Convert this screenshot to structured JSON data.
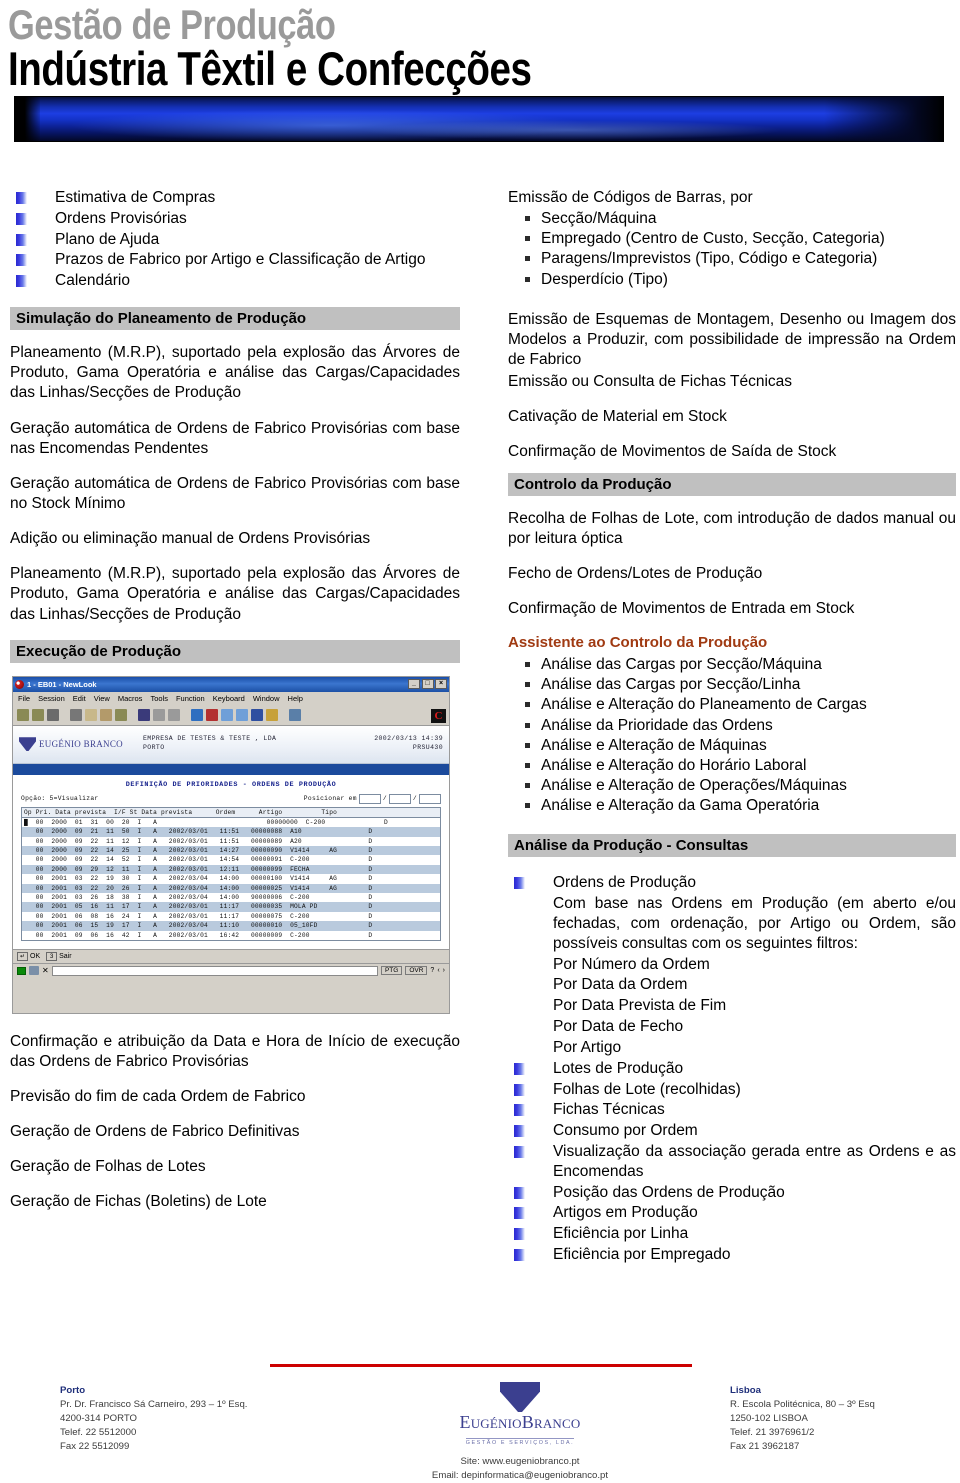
{
  "header": {
    "line1": "Gestão de Produção",
    "line2": "Indústria Têxtil e Confecções"
  },
  "left": {
    "top_bullets": [
      "Estimativa de Compras",
      "Ordens Provisórias",
      "Plano de Ajuda",
      "Prazos de Fabrico por Artigo e Classificação de Artigo",
      "Calendário"
    ],
    "section1_title": "Simulação do Planeamento de Produção",
    "section1_paras": [
      "Planeamento (M.R.P), suportado pela explosão das Árvores de Produto, Gama Operatória e análise das Cargas/Capacidades das Linhas/Secções de Produção",
      "Geração automática de Ordens de Fabrico Provisórias com base nas Encomendas Pendentes",
      "Geração automática de Ordens de Fabrico Provisórias com base no Stock Mínimo",
      "Adição ou eliminação manual de Ordens Provisórias",
      "Planeamento (M.R.P), suportado pela explosão das Árvores de Produto, Gama Operatória e análise das Cargas/Capacidades das Linhas/Secções de Produção"
    ],
    "section2_title": "Execução de Produção",
    "section2_paras": [
      "Confirmação e atribuição da Data e Hora de Início de execução das Ordens de Fabrico Provisórias",
      "Previsão do fim de cada Ordem de Fabrico",
      "Geração de Ordens de Fabrico Definitivas",
      "Geração de Folhas de Lotes",
      "Geração de Fichas (Boletins) de Lote"
    ]
  },
  "screenshot": {
    "window_title": "1 - EB01 - NewLook",
    "min_label": "_",
    "max_label": "□",
    "close_label": "×",
    "menus": [
      "File",
      "Session",
      "Edit",
      "View",
      "Macros",
      "Tools",
      "Function",
      "Keyboard",
      "Window",
      "Help"
    ],
    "company": "EMPRESA DE TESTES  & TESTE , LDA",
    "city": "PORTO",
    "datetime": "2002/03/13 14:39",
    "program_id": "PRSU430",
    "logo_text": "EUGÉNIO BRANCO",
    "form_title": "DEFINIÇÃO DE PRIORIDADES - ORDENS DE PRODUÇÃO",
    "option_label": "Opção: 5=Visualizar",
    "position_label": "Posicionar em",
    "grid_header": "Op Pri. Data prevista  I/F St Data prevista      Ordem      Artigo          Tipo",
    "grid_rows": [
      "█  00  2000  01  31  00  20  I   A                            00000000  C-200               D",
      "   00  2000  09  21  11  50  I   A   2002/03/01   11:51   00000088  A10                 D",
      "   00  2000  09  22  11  12  I   A   2002/03/01   11:51   00000089  A20                 D",
      "   00  2000  09  22  14  25  I   A   2002/03/01   14:27   00000090  V1414     AG        D",
      "   00  2000  09  22  14  52  I   A   2002/03/01   14:54   00000091  C-200               D",
      "   00  2000  09  29  12  11  I   A   2002/03/01   12:11   00000099  FECHA               D",
      "   00  2001  03  22  19  30  I   A   2002/03/04   14:00   00000100  V1414     AG        D",
      "   00  2001  03  22  20  26  I   A   2002/03/04   14:00   00000025  V1414     AG        D",
      "   00  2001  03  26  18  38  I   A   2002/03/04   14:00   90000006  C-200               D",
      "   00  2001  05  16  11  17  I   A   2002/03/01   11:17   00000035  MOLA PD             D",
      "   00  2001  06  08  16  24  I   A   2002/03/01   11:17   00000075  C-200               D",
      "   00  2001  06  15  19  17  I   A   2002/03/04   11:10   00000010  05_10FD             D",
      "   00  2001  09  06  16  42  I   A   2002/03/01   16:42   00000009  C-200               D"
    ],
    "ok_key": "↵",
    "ok_label": "OK",
    "exit_key": "3",
    "exit_label": "Sair",
    "status_ptg": "PTG",
    "status_ovr": "OVR",
    "status_help": "?"
  },
  "right": {
    "block1_lead": "Emissão de Códigos de Barras, por",
    "block1_items": [
      "Secção/Máquina",
      "Empregado (Centro de Custo, Secção, Categoria)",
      "Paragens/Imprevistos (Tipo, Código e Categoria)",
      "Desperdício (Tipo)"
    ],
    "paras_a": [
      "Emissão de Esquemas de Montagem, Desenho ou Imagem dos Modelos a Produzir, com possibilidade de impressão na Ordem de Fabrico",
      "Emissão ou Consulta de Fichas Técnicas",
      "Cativação de Material em Stock",
      "Confirmação de Movimentos de Saída de Stock"
    ],
    "section_control_title": "Controlo da Produção",
    "paras_b": [
      "Recolha de Folhas de Lote, com introdução de dados manual ou por leitura óptica",
      "Fecho de Ordens/Lotes de Produção",
      "Confirmação de Movimentos de Entrada em Stock"
    ],
    "assistant_title": "Assistente ao Controlo da Produção",
    "assistant_color": "#A03A12",
    "assistant_items": [
      "Análise das Cargas por Secção/Máquina",
      "Análise das Cargas por Secção/Linha",
      "Análise e Alteração do Planeamento de Cargas",
      "Análise da Prioridade das Ordens",
      "Análise e Alteração de Máquinas",
      "Análise e Alteração do Horário Laboral",
      "Análise e Alteração de Operações/Máquinas",
      "Análise e Alteração da Gama Operatória"
    ],
    "section_analysis_title": "Análise da Produção - Consultas",
    "analysis_first": "Ordens de Produção",
    "analysis_first_desc": "Com base nas Ordens em Produção (em aberto e/ou fechadas, com ordenação, por Artigo ou Ordem, são possíveis consultas com os seguintes filtros:",
    "analysis_filters": [
      "Por Número da Ordem",
      "Por Data da Ordem",
      "Por Data Prevista de Fim",
      "Por Data de Fecho",
      "Por Artigo"
    ],
    "analysis_bullets": [
      "Lotes de Produção",
      "Folhas de Lote (recolhidas)",
      "Fichas Técnicas",
      "Consumo por Ordem",
      "Visualização da associação gerada entre as Ordens e as Encomendas",
      "Posição das Ordens de Produção",
      "Artigos em Produção",
      "Eficiência por Linha",
      "Eficiência por Empregado"
    ]
  },
  "footer": {
    "left_city": "Porto",
    "left_lines": [
      "Pr. Dr. Francisco Sá Carneiro, 293 – 1º Esq.",
      "4200-314 PORTO",
      "Telef. 22 5512000",
      "Fax 22 5512099"
    ],
    "right_city": "Lisboa",
    "right_lines": [
      "R. Escola Politécnica, 80 – 3º Esq",
      "1250-102 LISBOA",
      "Telef. 21 3976961/2",
      "Fax 21 3962187"
    ],
    "logo_name_a": "E",
    "logo_name_b": "UGÉNIO",
    "logo_name_c": "B",
    "logo_name_d": "RANCO",
    "logo_sub": "GESTÃO E SERVIÇOS, LDA.",
    "site": "Site: www.eugeniobranco.pt",
    "email": "Email: depinformatica@eugeniobranco.pt",
    "rule_color": "#CC0000"
  }
}
